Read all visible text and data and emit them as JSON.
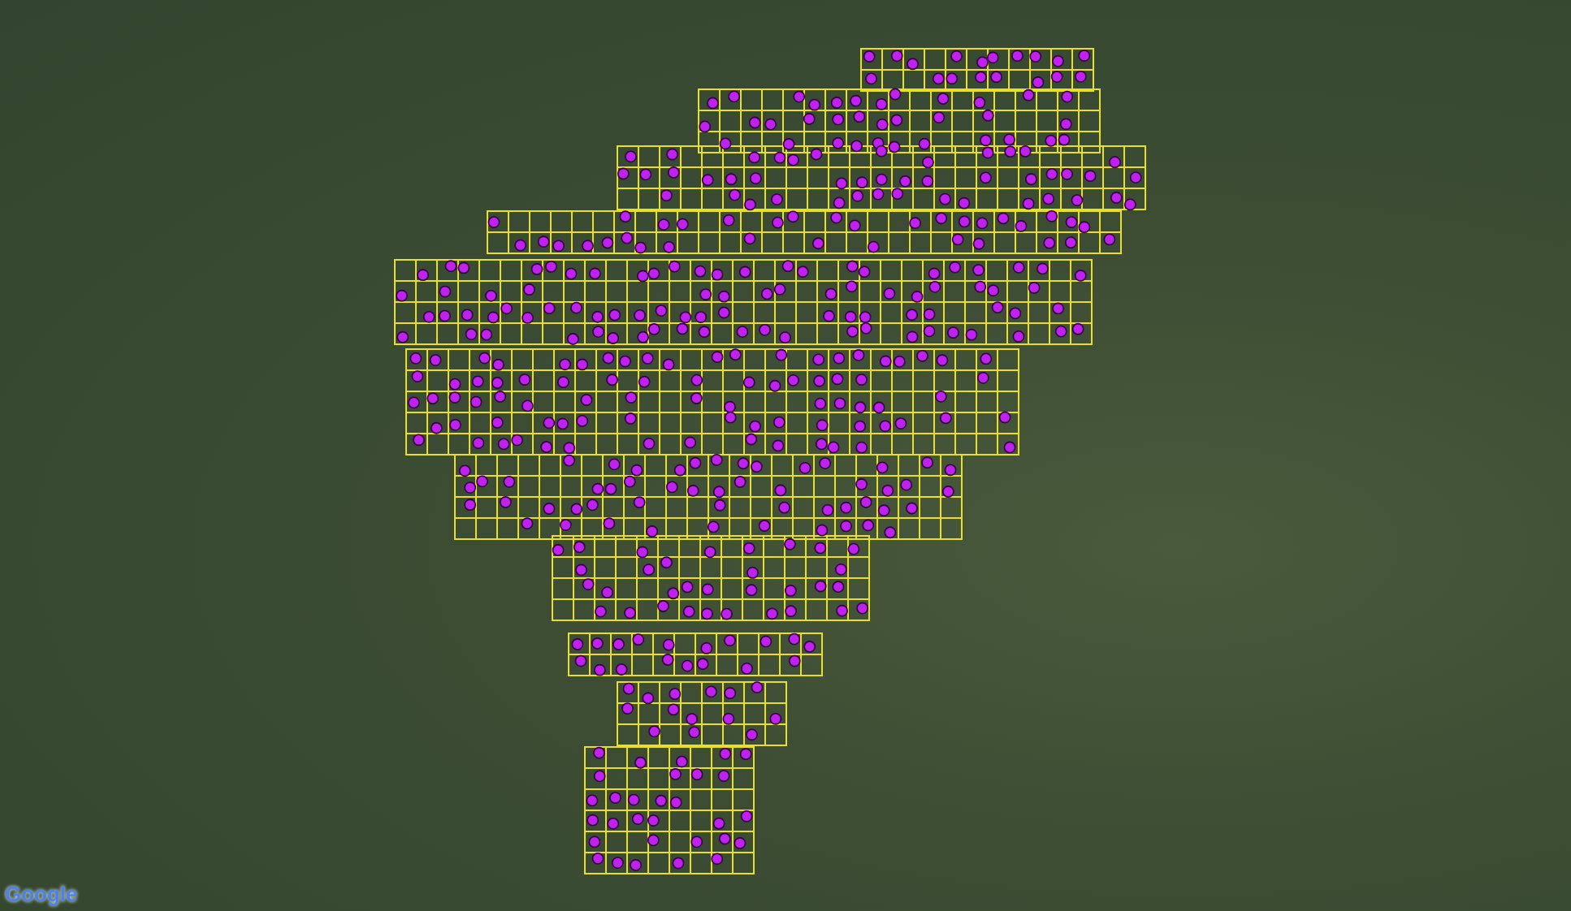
{
  "map": {
    "logo": "Google"
  }
}
